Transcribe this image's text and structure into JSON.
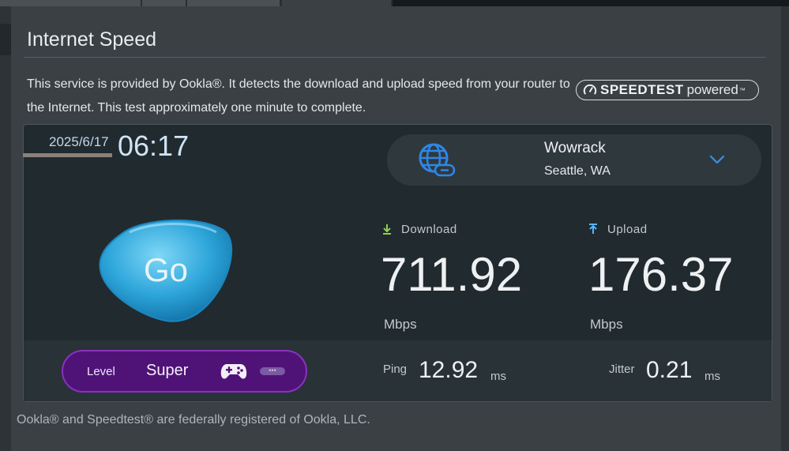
{
  "page": {
    "title": "Internet Speed",
    "description": "This service is provided by Ookla®. It detects the download and upload speed from your router to the Internet. This test approximately one minute to complete.",
    "badge": {
      "brand": "SPEEDTEST",
      "suffix": "powered",
      "tm": "™"
    },
    "footer": "Ookla® and Speedtest® are federally registered of Ookla, LLC."
  },
  "test": {
    "date": "2025/6/17",
    "time": "06:17",
    "go_label": "Go",
    "server": {
      "name": "Wowrack",
      "location": "Seattle, WA",
      "icon": "globe-link-icon"
    },
    "download": {
      "label": "Download",
      "value": "711.92",
      "unit": "Mbps"
    },
    "upload": {
      "label": "Upload",
      "value": "176.37",
      "unit": "Mbps"
    },
    "ping": {
      "label": "Ping",
      "value": "12.92",
      "unit": "ms"
    },
    "jitter": {
      "label": "Jitter",
      "value": "0.21",
      "unit": "ms"
    },
    "level": {
      "label": "Level",
      "value": "Super",
      "icon": "gamepad-icon"
    }
  },
  "colors": {
    "accent_blue": "#3a8fe6",
    "go_button": "#2fa8d8",
    "level_pill": "#4f1377",
    "download_arrow": "#8fd14f",
    "upload_arrow": "#5ab4ff"
  }
}
